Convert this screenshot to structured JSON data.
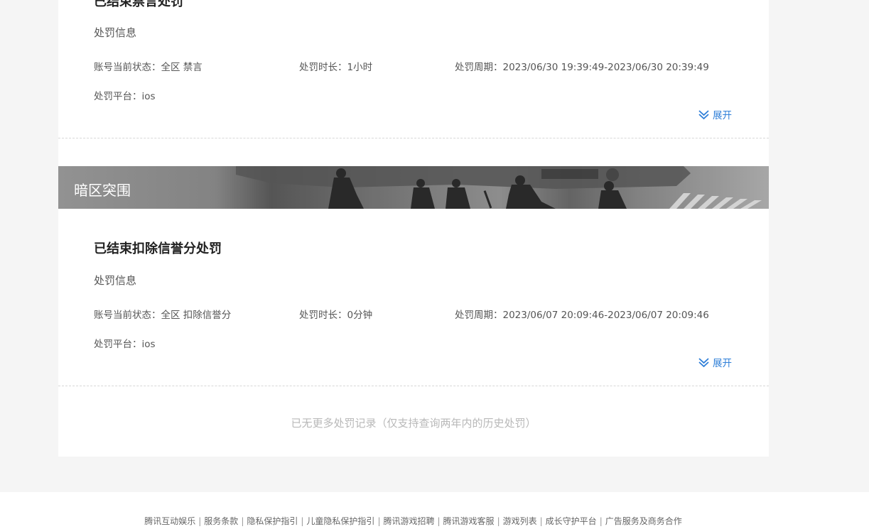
{
  "records": [
    {
      "title": "已结束禁言处罚",
      "section_label": "处罚信息",
      "status_label": "账号当前状态：",
      "status_value": "全区 禁言",
      "duration_label": "处罚时长：",
      "duration_value": "1小时",
      "period_label": "处罚周期：",
      "period_value": "2023/06/30 19:39:49-2023/06/30 20:39:49",
      "platform_label": "处罚平台：",
      "platform_value": "ios",
      "expand_label": "展开"
    },
    {
      "game_name": "暗区突围",
      "title": "已结束扣除信誉分处罚",
      "section_label": "处罚信息",
      "status_label": "账号当前状态：",
      "status_value": "全区 扣除信誉分",
      "duration_label": "处罚时长：",
      "duration_value": "0分钟",
      "period_label": "处罚周期：",
      "period_value": "2023/06/07 20:09:46-2023/06/07 20:09:46",
      "platform_label": "处罚平台：",
      "platform_value": "ios",
      "expand_label": "展开"
    }
  ],
  "no_more_text": "已无更多处罚记录（仅支持查询两年内的历史处罚）",
  "footer": {
    "links": [
      "腾讯互动娱乐",
      "服务条款",
      "隐私保护指引",
      "儿童隐私保护指引",
      "腾讯游戏招聘",
      "腾讯游戏客服",
      "游戏列表",
      "成长守护平台",
      "广告服务及商务合作"
    ],
    "separator": "|"
  },
  "colors": {
    "accent": "#2f7fd8",
    "page_bg": "#f5f5f5",
    "card_bg": "#ffffff"
  },
  "icons": {
    "expand": "double-chevron-down-icon"
  }
}
